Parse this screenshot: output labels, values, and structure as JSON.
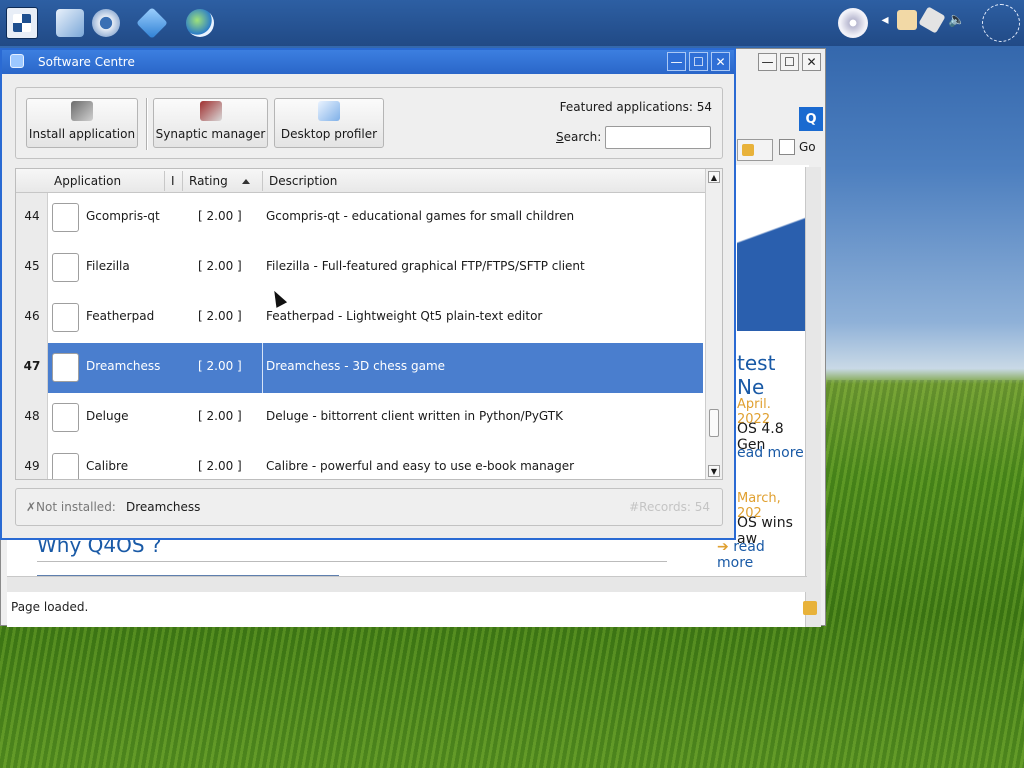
{
  "panel": {
    "icons": [
      "start-menu-icon",
      "editor-icon",
      "settings-gear-icon",
      "software-box-icon",
      "browser-globe-icon"
    ],
    "tray_icons": [
      "cd-icon",
      "arrow-left-icon",
      "tools-icon",
      "network-icon",
      "volume-icon",
      "clock-icon"
    ]
  },
  "browser": {
    "go_label": "Go",
    "status": "Page loaded.",
    "news_heading": "test Ne",
    "news_date_1": "April. 2022",
    "news_text_1": "OS 4.8 Gen",
    "news_more_1": "ead more",
    "news_date_2": "March, 202",
    "news_text_2": "OS wins aw",
    "news_more_2": "read more",
    "page_heading": "Why Q4OS ?"
  },
  "window": {
    "title": "Software Centre",
    "buttons": {
      "minimize": "—",
      "maximize": "☐",
      "close": "✕"
    }
  },
  "toolbar": {
    "install_label": "Install application",
    "synaptic_label": "Synaptic manager",
    "profiler_label": "Desktop profiler",
    "featured_text": "Featured applications:",
    "featured_count": "54",
    "search_label_prefix": "S",
    "search_label_rest": "earch:",
    "search_value": ""
  },
  "table": {
    "headers": {
      "application": "Application",
      "installed": "I",
      "rating": "Rating",
      "description": "Description"
    },
    "rows": [
      {
        "num": "44",
        "app": "Gcompris-qt",
        "rating": "[ 2.00 ]",
        "desc": "Gcompris-qt - educational games for small children"
      },
      {
        "num": "45",
        "app": "Filezilla",
        "rating": "[ 2.00 ]",
        "desc": "Filezilla - Full-featured graphical FTP/FTPS/SFTP client"
      },
      {
        "num": "46",
        "app": "Featherpad",
        "rating": "[ 2.00 ]",
        "desc": "Featherpad - Lightweight Qt5 plain-text editor"
      },
      {
        "num": "47",
        "app": "Dreamchess",
        "rating": "[ 2.00 ]",
        "desc": "Dreamchess - 3D chess game"
      },
      {
        "num": "48",
        "app": "Deluge",
        "rating": "[ 2.00 ]",
        "desc": "Deluge - bittorrent client written in Python/PyGTK"
      },
      {
        "num": "49",
        "app": "Calibre",
        "rating": "[ 2.00 ]",
        "desc": "Calibre - powerful and easy to use e-book manager"
      }
    ]
  },
  "status": {
    "label": "✗Not installed:",
    "value": "Dreamchess",
    "records": "#Records: 54"
  },
  "colors": {
    "selection": "#4a7ece",
    "titlebar": "#2a66c9",
    "accent_orange": "#e0a030"
  }
}
